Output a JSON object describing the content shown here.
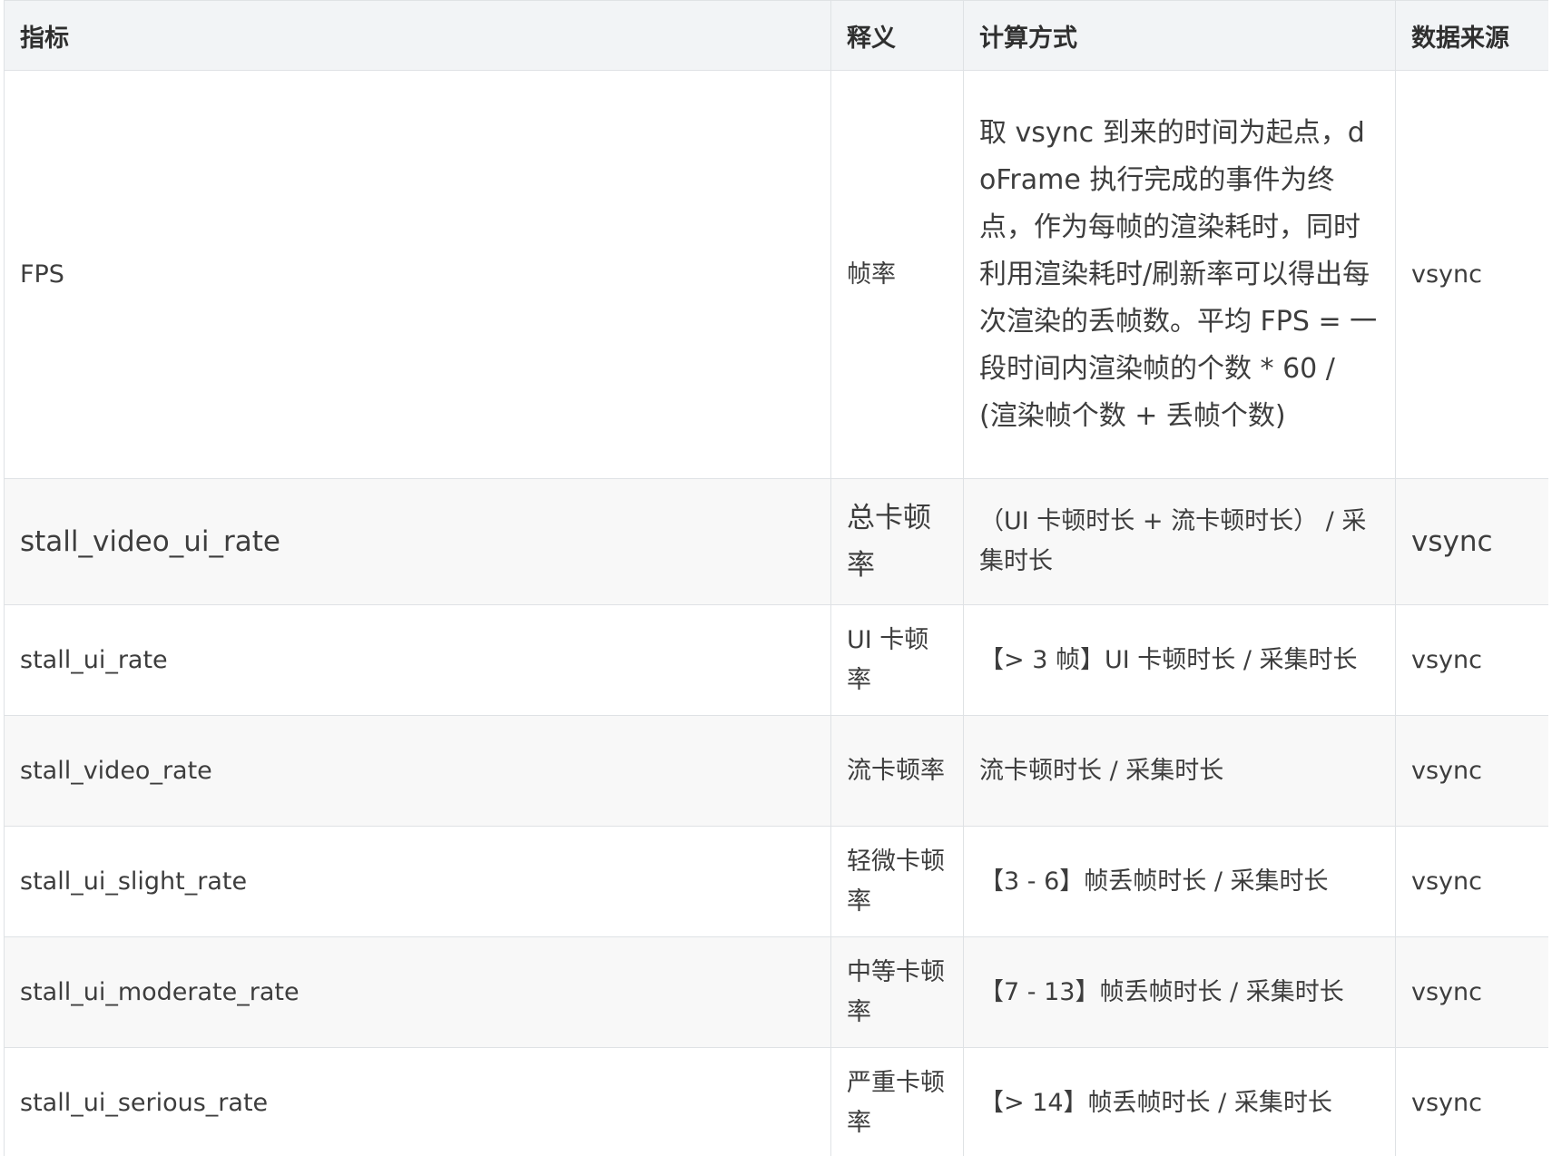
{
  "table": {
    "headers": [
      "指标",
      "释义",
      "计算方式",
      "数据来源"
    ],
    "rows": [
      {
        "metric": "FPS",
        "meaning": "帧率",
        "calculation": "取 vsync 到来的时间为起点，doFrame 执行完成的事件为终点，作为每帧的渲染耗时，同时利用渲染耗时/刷新率可以得出每次渲染的丢帧数。平均 FPS = 一段时间内渲染帧的个数 * 60 / (渲染帧个数 + 丢帧个数)",
        "source": "vsync"
      },
      {
        "metric": "stall_video_ui_rate",
        "meaning": "总卡顿率",
        "calculation": "（UI 卡顿时长 + 流卡顿时长） / 采集时长",
        "source": "vsync"
      },
      {
        "metric": "stall_ui_rate",
        "meaning": "UI 卡顿率",
        "calculation": "【> 3 帧】UI 卡顿时长 / 采集时长",
        "source": "vsync"
      },
      {
        "metric": "stall_video_rate",
        "meaning": "流卡顿率",
        "calculation": "流卡顿时长 / 采集时长",
        "source": "vsync"
      },
      {
        "metric": "stall_ui_slight_rate",
        "meaning": "轻微卡顿率",
        "calculation": "【3 - 6】帧丢帧时长 / 采集时长",
        "source": "vsync"
      },
      {
        "metric": "stall_ui_moderate_rate",
        "meaning": "中等卡顿率",
        "calculation": "【7 - 13】帧丢帧时长 / 采集时长",
        "source": "vsync"
      },
      {
        "metric": "stall_ui_serious_rate",
        "meaning": "严重卡顿率",
        "calculation": "【> 14】帧丢帧时长 / 采集时长",
        "source": "vsync"
      }
    ]
  }
}
